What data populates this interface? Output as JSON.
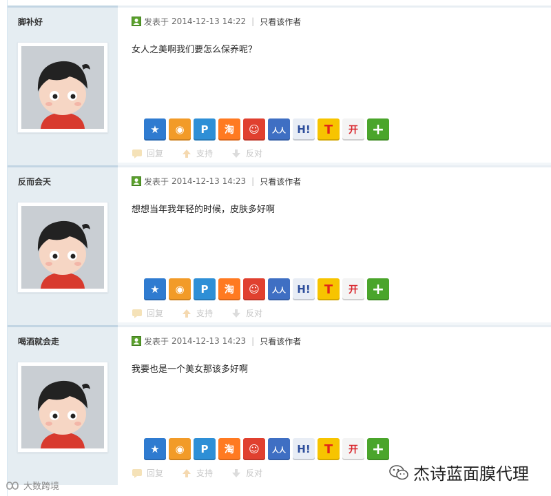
{
  "meta_prefix": "发表于",
  "author_only": "只看该作者",
  "actions": {
    "reply": "回复",
    "support": "支持",
    "oppose": "反对"
  },
  "share_buttons": [
    {
      "icon": "qzone-star-icon",
      "glyph": "★",
      "color": "#2f7bd0"
    },
    {
      "icon": "weibo-icon",
      "glyph": "◉",
      "color": "#f29b28"
    },
    {
      "icon": "pengyou-icon",
      "glyph": "P",
      "color": "#2e8fd6"
    },
    {
      "icon": "taobao-icon",
      "glyph": "淘",
      "color": "#ff7a21"
    },
    {
      "icon": "qq-star-icon",
      "glyph": "☺",
      "color": "#e0402f"
    },
    {
      "icon": "renren-icon",
      "glyph": "人人",
      "color": "#3f6fc3"
    },
    {
      "icon": "hi-icon",
      "glyph": "H!",
      "color": "#2d4e9c"
    },
    {
      "icon": "tianya-icon",
      "glyph": "T",
      "color": "#e1251b"
    },
    {
      "icon": "kaixin-icon",
      "glyph": "开",
      "color": "#d9252b"
    },
    {
      "icon": "more-plus-icon",
      "glyph": "+",
      "color": "#4aa52b"
    }
  ],
  "posts": [
    {
      "author": "脚补好",
      "time": "2014-12-13 14:22",
      "content": "女人之美啊我们要怎么保养呢？"
    },
    {
      "author": "反而会天",
      "time": "2014-12-13 14:23",
      "content": "想想当年我年轻的时候，皮肤多好啊"
    },
    {
      "author": "喝酒就会走",
      "time": "2014-12-13 14:23",
      "content": "我要也是一个美女那该多好啊"
    }
  ],
  "watermark": "杰诗蓝面膜代理",
  "corner_logo": "大数跨境",
  "colors": {
    "sidebar_bg": "#e5edf2",
    "sidebar_border": "#c2d5e3",
    "green_icon": "#5aa02c"
  }
}
